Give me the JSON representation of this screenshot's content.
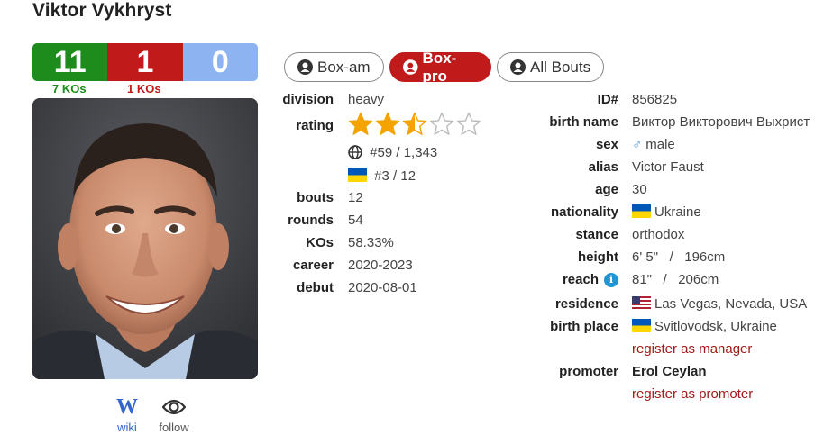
{
  "boxer": {
    "name": "Viktor Vykhryst"
  },
  "record": {
    "wins": "11",
    "losses": "1",
    "draws": "0",
    "ko_wins": "7 KOs",
    "ko_losses": "1 KOs"
  },
  "links": {
    "wiki": "wiki",
    "follow": "follow",
    "wiki_glyph": "W"
  },
  "tabs": {
    "amateur": "Box-am",
    "pro": "Box-pro",
    "all": "All Bouts"
  },
  "left_stats": {
    "division_label": "division",
    "division": "heavy",
    "rating_label": "rating",
    "stars": 2.5,
    "stars_max": 5,
    "world_rank": "#59 / 1,343",
    "country_rank": "#3 / 12",
    "bouts_label": "bouts",
    "bouts": "12",
    "rounds_label": "rounds",
    "rounds": "54",
    "kos_label": "KOs",
    "kos": "58.33%",
    "career_label": "career",
    "career": "2020-2023",
    "debut_label": "debut",
    "debut": "2020-08-01"
  },
  "right_stats": {
    "id_label": "ID#",
    "id": "856825",
    "birth_name_label": "birth name",
    "birth_name": "Виктор Викторович Выхрист",
    "sex_label": "sex",
    "sex_symbol": "♂",
    "sex": "male",
    "alias_label": "alias",
    "alias": "Victor Faust",
    "age_label": "age",
    "age": "30",
    "nationality_label": "nationality",
    "nationality": "Ukraine",
    "stance_label": "stance",
    "stance": "orthodox",
    "height_label": "height",
    "height_imperial": "6' 5\"",
    "height_sep": "/",
    "height_metric": "196cm",
    "reach_label": "reach",
    "reach_info": "i",
    "reach_imperial": "81\"",
    "reach_sep": "/",
    "reach_metric": "206cm",
    "residence_label": "residence",
    "residence": "Las Vegas, Nevada, USA",
    "birth_place_label": "birth place",
    "birth_place": "Svitlovodsk, Ukraine",
    "register_manager": "register as manager",
    "promoter_label": "promoter",
    "promoter": "Erol Ceylan",
    "register_promoter": "register as promoter"
  },
  "colors": {
    "win": "#1d8c1d",
    "loss": "#c01a1a",
    "draw": "#8db4f0",
    "star": "#f5a300",
    "link_red": "#a31a1a",
    "wiki_blue": "#3366cc"
  },
  "icons": [
    "user-icon",
    "globe-icon",
    "ukraine-flag-icon",
    "usa-flag-icon",
    "male-icon",
    "info-icon",
    "eye-icon",
    "wikipedia-icon",
    "star-icon"
  ]
}
